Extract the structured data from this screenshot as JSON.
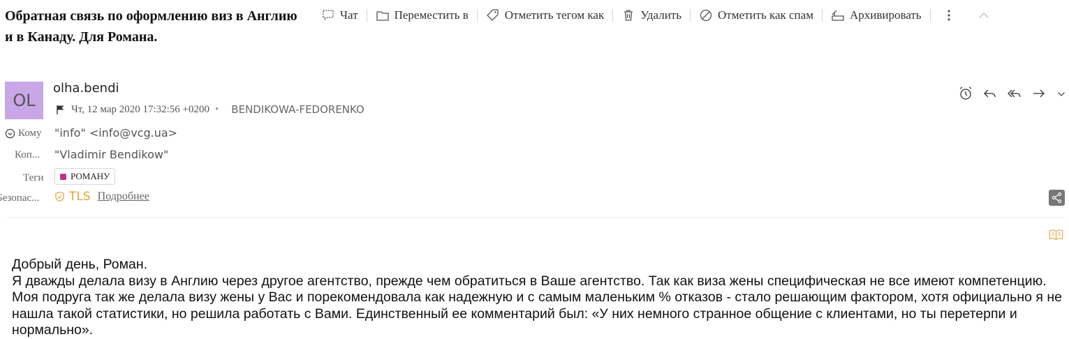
{
  "subject": "Обратная связь по оформлению виз в Англию и в Канаду. Для Романа.",
  "toolbar": {
    "chat": "Чат",
    "move": "Переместить в",
    "tag": "Отметить тегом как",
    "delete": "Удалить",
    "spam": "Отметить как спам",
    "archive": "Архивировать"
  },
  "message": {
    "avatar_initials": "OL",
    "sender": "olha.bendi",
    "date": "Чт, 12 мар 2020 17:32:56 +0200",
    "organization": "BENDIKOWA-FEDORENKO",
    "to_label": "Кому",
    "to_value": "\"info\" <info@vcg.ua>",
    "cc_label": "Коп...",
    "cc_value": "\"Vladimir Bendikow\"",
    "tags_label": "Теги",
    "tag_name": "РОМАНУ",
    "security_label": "Безопас...",
    "security_value": "TLS",
    "security_more": "Подробнее"
  },
  "body": [
    "Добрый день, Роман.",
    "Я дважды делала визу в Англию через другое агентство, прежде чем обратиться в Ваше агентство. Так как виза жены специфическая не все имеют компетенцию. Моя подруга так же делала визу жены у Вас и порекомендовала как надежную и с самым маленьким % отказов - стало решающим фактором, хотя официально я не нашла такой статистики, но решила работать с Вами. Единственный ее комментарий был: «У них немного странное общение с клиентами, но ты перетерпи и нормально»."
  ],
  "colors": {
    "avatar": "#c9a6e6",
    "tag_dot": "#c0338a",
    "tls": "#e8a23a"
  }
}
